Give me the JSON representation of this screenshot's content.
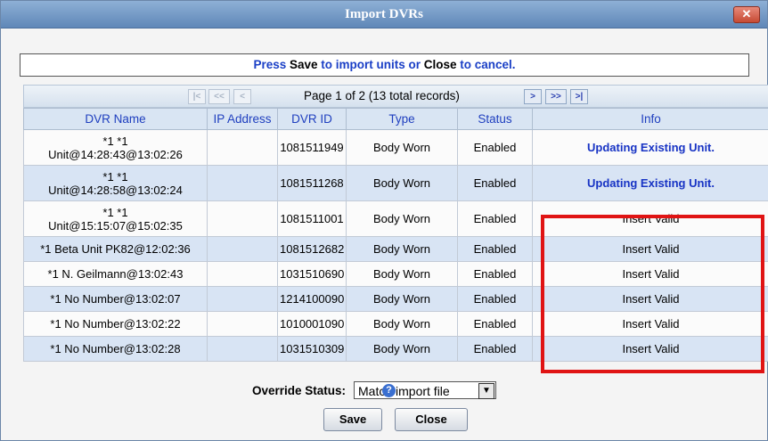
{
  "dialog": {
    "title": "Import DVRs",
    "close_glyph": "✕"
  },
  "prompt": {
    "part1": "Press ",
    "save_word": "Save",
    "part2": " to import units or ",
    "close_word": "Close",
    "part3": " to cancel."
  },
  "pager": {
    "first": "|<",
    "prev_page": "<<",
    "prev": "<",
    "text": "Page 1 of 2 (13 total records)",
    "next": ">",
    "next_page": ">>",
    "last": ">|"
  },
  "table": {
    "headers": [
      "DVR Name",
      "IP Address",
      "DVR ID",
      "Type",
      "Status",
      "Info"
    ],
    "rows": [
      {
        "name_line1": "*1 *1",
        "name_line2": "Unit@14:28:43@13:02:26",
        "ip": "",
        "dvr_id": "1081511949",
        "type": "Body Worn",
        "status": "Enabled",
        "info": "Updating Existing Unit."
      },
      {
        "name_line1": "*1 *1",
        "name_line2": "Unit@14:28:58@13:02:24",
        "ip": "",
        "dvr_id": "1081511268",
        "type": "Body Worn",
        "status": "Enabled",
        "info": "Updating Existing Unit."
      },
      {
        "name_line1": "*1 *1",
        "name_line2": "Unit@15:15:07@15:02:35",
        "ip": "",
        "dvr_id": "1081511001",
        "type": "Body Worn",
        "status": "Enabled",
        "info": "Insert Valid"
      },
      {
        "name": "*1 Beta Unit PK82@12:02:36",
        "ip": "",
        "dvr_id": "1081512682",
        "type": "Body Worn",
        "status": "Enabled",
        "info": "Insert Valid"
      },
      {
        "name": "*1 N. Geilmann@13:02:43",
        "ip": "",
        "dvr_id": "1031510690",
        "type": "Body Worn",
        "status": "Enabled",
        "info": "Insert Valid"
      },
      {
        "name": "*1 No Number@13:02:07",
        "ip": "",
        "dvr_id": "1214100090",
        "type": "Body Worn",
        "status": "Enabled",
        "info": "Insert Valid"
      },
      {
        "name": "*1 No Number@13:02:22",
        "ip": "",
        "dvr_id": "1010001090",
        "type": "Body Worn",
        "status": "Enabled",
        "info": "Insert Valid"
      },
      {
        "name": "*1 No Number@13:02:28",
        "ip": "",
        "dvr_id": "1031510309",
        "type": "Body Worn",
        "status": "Enabled",
        "info": "Insert Valid"
      }
    ]
  },
  "override": {
    "label": "Override Status:",
    "selected": "Match import file",
    "help_glyph": "?"
  },
  "buttons": {
    "save": "Save",
    "close": "Close"
  },
  "colors": {
    "accent_text": "#1733c4",
    "highlight_box": "#e01414"
  }
}
